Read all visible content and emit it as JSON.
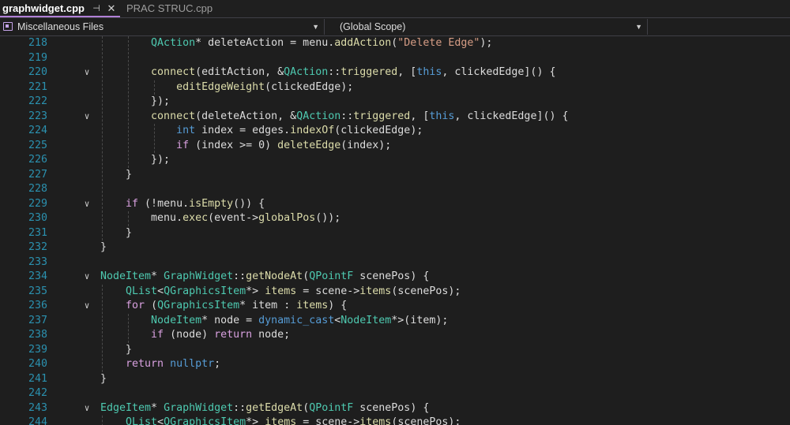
{
  "tabs": [
    {
      "label": "graphwidget.cpp",
      "pin_icon": "pin-icon",
      "close_icon": "close-icon"
    },
    {
      "label": "PRAC STRUC.cpp"
    }
  ],
  "nav": {
    "project": "Miscellaneous Files",
    "scope": "(Global Scope)"
  },
  "editor": {
    "lines": [
      {
        "n": "218",
        "fold": false,
        "code": "        QAction* deleteAction = menu.addAction(\"Delete Edge\");"
      },
      {
        "n": "219",
        "fold": false,
        "code": ""
      },
      {
        "n": "220",
        "fold": true,
        "code": "        connect(editAction, &QAction::triggered, [this, clickedEdge]() {"
      },
      {
        "n": "221",
        "fold": false,
        "code": "            editEdgeWeight(clickedEdge);"
      },
      {
        "n": "222",
        "fold": false,
        "code": "        });"
      },
      {
        "n": "223",
        "fold": true,
        "code": "        connect(deleteAction, &QAction::triggered, [this, clickedEdge]() {"
      },
      {
        "n": "224",
        "fold": false,
        "code": "            int index = edges.indexOf(clickedEdge);"
      },
      {
        "n": "225",
        "fold": false,
        "code": "            if (index >= 0) deleteEdge(index);"
      },
      {
        "n": "226",
        "fold": false,
        "code": "        });"
      },
      {
        "n": "227",
        "fold": false,
        "code": "    }"
      },
      {
        "n": "228",
        "fold": false,
        "code": ""
      },
      {
        "n": "229",
        "fold": true,
        "code": "    if (!menu.isEmpty()) {"
      },
      {
        "n": "230",
        "fold": false,
        "code": "        menu.exec(event->globalPos());"
      },
      {
        "n": "231",
        "fold": false,
        "code": "    }"
      },
      {
        "n": "232",
        "fold": false,
        "code": "}"
      },
      {
        "n": "233",
        "fold": false,
        "code": ""
      },
      {
        "n": "234",
        "fold": true,
        "code": "NodeItem* GraphWidget::getNodeAt(QPointF scenePos) {"
      },
      {
        "n": "235",
        "fold": false,
        "code": "    QList<QGraphicsItem*> items = scene->items(scenePos);"
      },
      {
        "n": "236",
        "fold": true,
        "code": "    for (QGraphicsItem* item : items) {"
      },
      {
        "n": "237",
        "fold": false,
        "code": "        NodeItem* node = dynamic_cast<NodeItem*>(item);"
      },
      {
        "n": "238",
        "fold": false,
        "code": "        if (node) return node;"
      },
      {
        "n": "239",
        "fold": false,
        "code": "    }"
      },
      {
        "n": "240",
        "fold": false,
        "code": "    return nullptr;"
      },
      {
        "n": "241",
        "fold": false,
        "code": "}"
      },
      {
        "n": "242",
        "fold": false,
        "code": ""
      },
      {
        "n": "243",
        "fold": true,
        "code": "EdgeItem* GraphWidget::getEdgeAt(QPointF scenePos) {"
      },
      {
        "n": "244",
        "fold": false,
        "code": "    QList<QGraphicsItem*> items = scene->items(scenePos);"
      }
    ]
  },
  "colors": {
    "background": "#1e1e1e",
    "line_number": "#2b91af",
    "keyword": "#569cd6",
    "control_keyword": "#d8a0df",
    "type": "#4ec9b0",
    "function": "#dcdcaa",
    "string": "#d69d85",
    "active_tab_accent": "#b180d7"
  }
}
